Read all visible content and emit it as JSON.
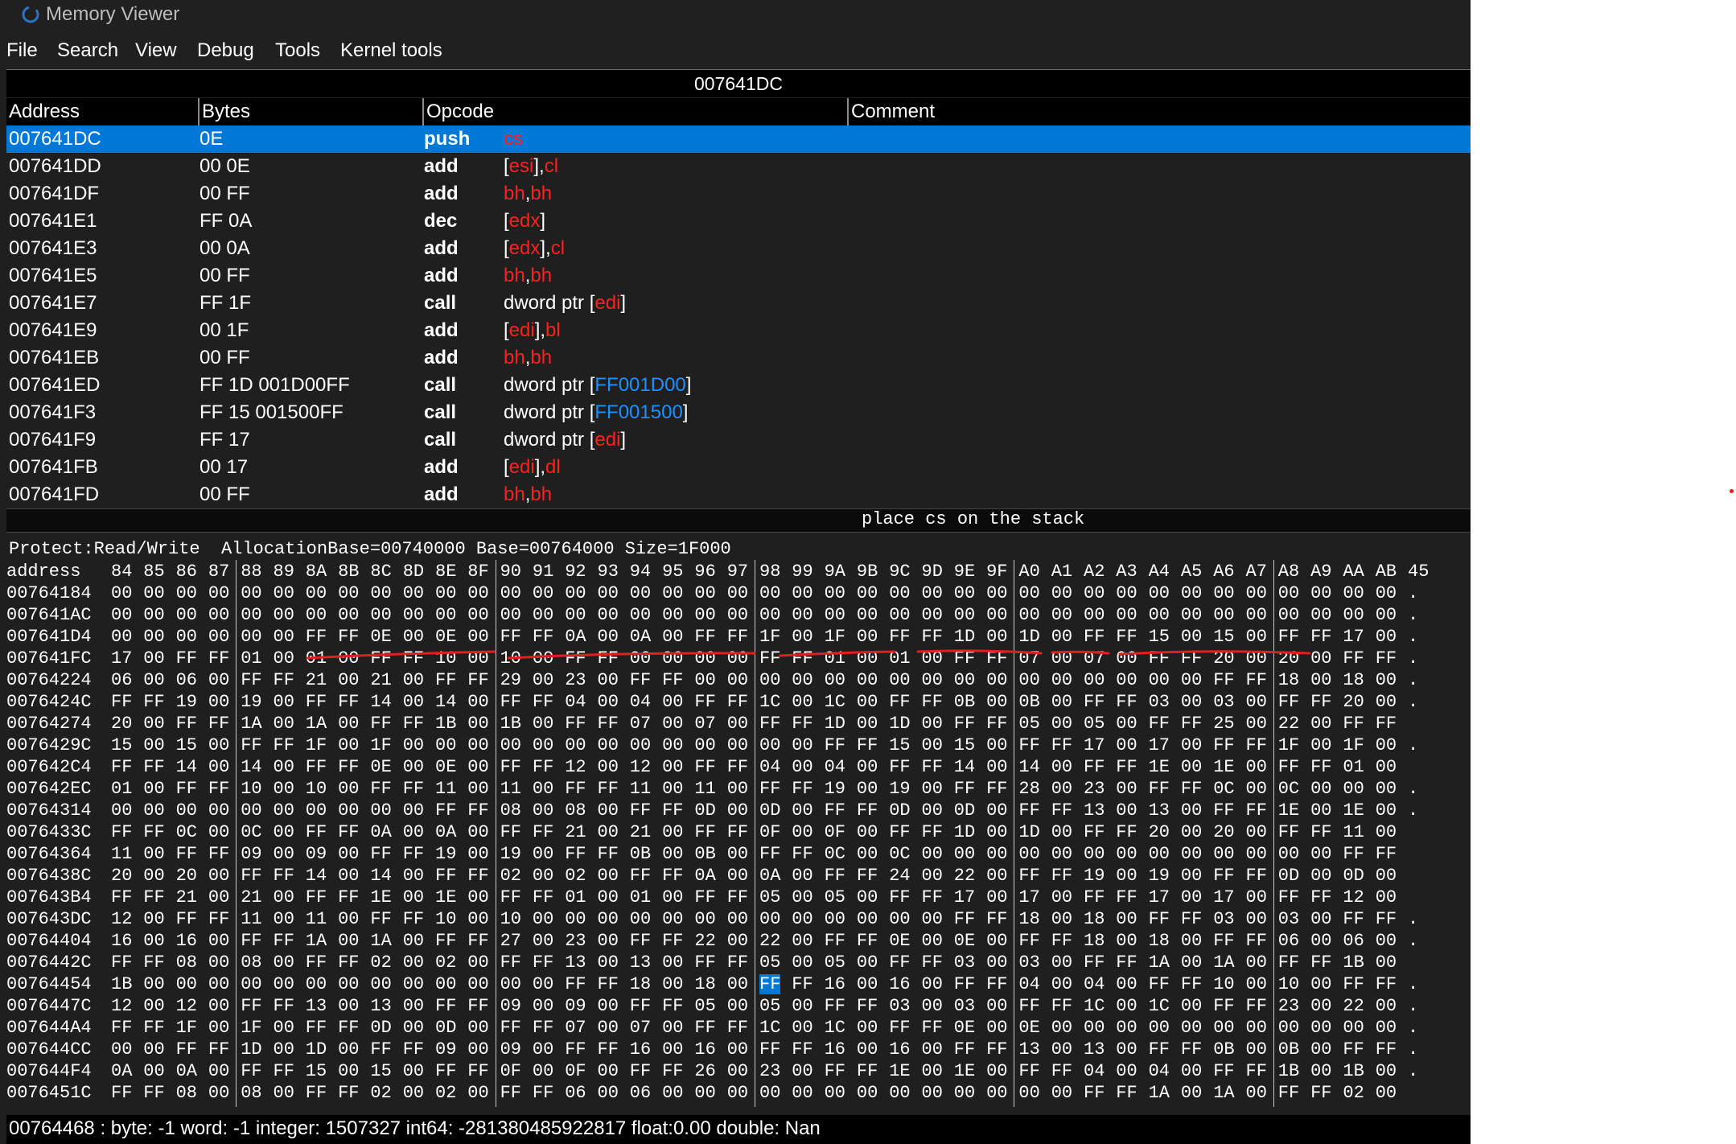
{
  "window": {
    "title": "Memory Viewer"
  },
  "menu": [
    "File",
    "Search",
    "View",
    "Debug",
    "Tools",
    "Kernel tools"
  ],
  "disassembler": {
    "current_address": "007641DC",
    "columns": [
      "Address",
      "Bytes",
      "Opcode",
      "Comment"
    ],
    "rows": [
      {
        "address": "007641DC",
        "bytes": "0E",
        "opcode": "push",
        "args": [
          {
            "t": "cs",
            "k": "reg"
          }
        ],
        "selected": true
      },
      {
        "address": "007641DD",
        "bytes": "00 0E",
        "opcode": "add",
        "args": [
          {
            "t": "[",
            "k": "plain"
          },
          {
            "t": "esi",
            "k": "reg"
          },
          {
            "t": "],",
            "k": "plain"
          },
          {
            "t": "cl",
            "k": "reg"
          }
        ]
      },
      {
        "address": "007641DF",
        "bytes": "00 FF",
        "opcode": "add",
        "args": [
          {
            "t": "bh",
            "k": "reg"
          },
          {
            "t": ",",
            "k": "plain"
          },
          {
            "t": "bh",
            "k": "reg"
          }
        ]
      },
      {
        "address": "007641E1",
        "bytes": "FF 0A",
        "opcode": "dec",
        "args": [
          {
            "t": "[",
            "k": "plain"
          },
          {
            "t": "edx",
            "k": "reg"
          },
          {
            "t": "]",
            "k": "plain"
          }
        ]
      },
      {
        "address": "007641E3",
        "bytes": "00 0A",
        "opcode": "add",
        "args": [
          {
            "t": "[",
            "k": "plain"
          },
          {
            "t": "edx",
            "k": "reg"
          },
          {
            "t": "],",
            "k": "plain"
          },
          {
            "t": "cl",
            "k": "reg"
          }
        ]
      },
      {
        "address": "007641E5",
        "bytes": "00 FF",
        "opcode": "add",
        "args": [
          {
            "t": "bh",
            "k": "reg"
          },
          {
            "t": ",",
            "k": "plain"
          },
          {
            "t": "bh",
            "k": "reg"
          }
        ]
      },
      {
        "address": "007641E7",
        "bytes": "FF 1F",
        "opcode": "call",
        "args": [
          {
            "t": "dword ptr [",
            "k": "plain"
          },
          {
            "t": "edi",
            "k": "reg"
          },
          {
            "t": "]",
            "k": "plain"
          }
        ]
      },
      {
        "address": "007641E9",
        "bytes": "00 1F",
        "opcode": "add",
        "args": [
          {
            "t": "[",
            "k": "plain"
          },
          {
            "t": "edi",
            "k": "reg"
          },
          {
            "t": "],",
            "k": "plain"
          },
          {
            "t": "bl",
            "k": "reg"
          }
        ]
      },
      {
        "address": "007641EB",
        "bytes": "00 FF",
        "opcode": "add",
        "args": [
          {
            "t": "bh",
            "k": "reg"
          },
          {
            "t": ",",
            "k": "plain"
          },
          {
            "t": "bh",
            "k": "reg"
          }
        ]
      },
      {
        "address": "007641ED",
        "bytes": "FF 1D 001D00FF",
        "opcode": "call",
        "args": [
          {
            "t": "dword ptr [",
            "k": "plain"
          },
          {
            "t": "FF001D00",
            "k": "num"
          },
          {
            "t": "]",
            "k": "plain"
          }
        ]
      },
      {
        "address": "007641F3",
        "bytes": "FF 15 001500FF",
        "opcode": "call",
        "args": [
          {
            "t": "dword ptr [",
            "k": "plain"
          },
          {
            "t": "FF001500",
            "k": "num"
          },
          {
            "t": "]",
            "k": "plain"
          }
        ]
      },
      {
        "address": "007641F9",
        "bytes": "FF 17",
        "opcode": "call",
        "args": [
          {
            "t": "dword ptr [",
            "k": "plain"
          },
          {
            "t": "edi",
            "k": "reg"
          },
          {
            "t": "]",
            "k": "plain"
          }
        ]
      },
      {
        "address": "007641FB",
        "bytes": "00 17",
        "opcode": "add",
        "args": [
          {
            "t": "[",
            "k": "plain"
          },
          {
            "t": "edi",
            "k": "reg"
          },
          {
            "t": "],",
            "k": "plain"
          },
          {
            "t": "dl",
            "k": "reg"
          }
        ]
      },
      {
        "address": "007641FD",
        "bytes": "00 FF",
        "opcode": "add",
        "args": [
          {
            "t": "bh",
            "k": "reg"
          },
          {
            "t": ",",
            "k": "plain"
          },
          {
            "t": "bh",
            "k": "reg"
          }
        ]
      }
    ],
    "comment": "place cs on the stack"
  },
  "hexview": {
    "info": "Protect:Read/Write  AllocationBase=00740000 Base=00764000 Size=1F000",
    "header_label": "address",
    "header_cols": [
      "84",
      "85",
      "86",
      "87",
      "88",
      "89",
      "8A",
      "8B",
      "8C",
      "8D",
      "8E",
      "8F",
      "90",
      "91",
      "92",
      "93",
      "94",
      "95",
      "96",
      "97",
      "98",
      "99",
      "9A",
      "9B",
      "9C",
      "9D",
      "9E",
      "9F",
      "A0",
      "A1",
      "A2",
      "A3",
      "A4",
      "A5",
      "A6",
      "A7",
      "A8",
      "A9",
      "AA",
      "AB",
      "45"
    ],
    "rows": [
      {
        "addr": "00764184",
        "bytes": "00 00 00 00 00 00 00 00 00 00 00 00 00 00 00 00 00 00 00 00 00 00 00 00 00 00 00 00 00 00 00 00 00 00 00 00 00 00 00 00",
        "tail": "."
      },
      {
        "addr": "007641AC",
        "bytes": "00 00 00 00 00 00 00 00 00 00 00 00 00 00 00 00 00 00 00 00 00 00 00 00 00 00 00 00 00 00 00 00 00 00 00 00 00 00 00 00",
        "tail": "."
      },
      {
        "addr": "007641D4",
        "bytes": "00 00 00 00 00 00 FF FF 0E 00 0E 00 FF FF 0A 00 0A 00 FF FF 1F 00 1F 00 FF FF 1D 00 1D 00 FF FF 15 00 15 00 FF FF 17 00",
        "tail": "."
      },
      {
        "addr": "007641FC",
        "bytes": "17 00 FF FF 01 00 01 00 FF FF 10 00 10 00 FF FF 00 00 00 00 FF FF 01 00 01 00 FF FF 07 00 07 00 FF FF 20 00 20 00 FF FF",
        "tail": "."
      },
      {
        "addr": "00764224",
        "bytes": "06 00 06 00 FF FF 21 00 21 00 FF FF 29 00 23 00 FF FF 00 00 00 00 00 00 00 00 00 00 00 00 00 00 00 00 FF FF 18 00 18 00",
        "tail": "."
      },
      {
        "addr": "0076424C",
        "bytes": "FF FF 19 00 19 00 FF FF 14 00 14 00 FF FF 04 00 04 00 FF FF 1C 00 1C 00 FF FF 0B 00 0B 00 FF FF 03 00 03 00 FF FF 20 00",
        "tail": "."
      },
      {
        "addr": "00764274",
        "bytes": "20 00 FF FF 1A 00 1A 00 FF FF 1B 00 1B 00 FF FF 07 00 07 00 FF FF 1D 00 1D 00 FF FF 05 00 05 00 FF FF 25 00 22 00 FF FF",
        "tail": ""
      },
      {
        "addr": "0076429C",
        "bytes": "15 00 15 00 FF FF 1F 00 1F 00 00 00 00 00 00 00 00 00 00 00 00 00 FF FF 15 00 15 00 FF FF 17 00 17 00 FF FF 1F 00 1F 00",
        "tail": "."
      },
      {
        "addr": "007642C4",
        "bytes": "FF FF 14 00 14 00 FF FF 0E 00 0E 00 FF FF 12 00 12 00 FF FF 04 00 04 00 FF FF 14 00 14 00 FF FF 1E 00 1E 00 FF FF 01 00",
        "tail": ""
      },
      {
        "addr": "007642EC",
        "bytes": "01 00 FF FF 10 00 10 00 FF FF 11 00 11 00 FF FF 11 00 11 00 FF FF 19 00 19 00 FF FF 28 00 23 00 FF FF 0C 00 0C 00 00 00",
        "tail": "."
      },
      {
        "addr": "00764314",
        "bytes": "00 00 00 00 00 00 00 00 00 00 FF FF 08 00 08 00 FF FF 0D 00 0D 00 FF FF 0D 00 0D 00 FF FF 13 00 13 00 FF FF 1E 00 1E 00",
        "tail": "."
      },
      {
        "addr": "0076433C",
        "bytes": "FF FF 0C 00 0C 00 FF FF 0A 00 0A 00 FF FF 21 00 21 00 FF FF 0F 00 0F 00 FF FF 1D 00 1D 00 FF FF 20 00 20 00 FF FF 11 00",
        "tail": ""
      },
      {
        "addr": "00764364",
        "bytes": "11 00 FF FF 09 00 09 00 FF FF 19 00 19 00 FF FF 0B 00 0B 00 FF FF 0C 00 0C 00 00 00 00 00 00 00 00 00 00 00 00 00 FF FF",
        "tail": ""
      },
      {
        "addr": "0076438C",
        "bytes": "20 00 20 00 FF FF 14 00 14 00 FF FF 02 00 02 00 FF FF 0A 00 0A 00 FF FF 24 00 22 00 FF FF 19 00 19 00 FF FF 0D 00 0D 00",
        "tail": ""
      },
      {
        "addr": "007643B4",
        "bytes": "FF FF 21 00 21 00 FF FF 1E 00 1E 00 FF FF 01 00 01 00 FF FF 05 00 05 00 FF FF 17 00 17 00 FF FF 17 00 17 00 FF FF 12 00",
        "tail": ""
      },
      {
        "addr": "007643DC",
        "bytes": "12 00 FF FF 11 00 11 00 FF FF 10 00 10 00 00 00 00 00 00 00 00 00 00 00 00 00 FF FF 18 00 18 00 FF FF 03 00 03 00 FF FF",
        "tail": "."
      },
      {
        "addr": "00764404",
        "bytes": "16 00 16 00 FF FF 1A 00 1A 00 FF FF 27 00 23 00 FF FF 22 00 22 00 FF FF 0E 00 0E 00 FF FF 18 00 18 00 FF FF 06 00 06 00",
        "tail": "."
      },
      {
        "addr": "0076442C",
        "bytes": "FF FF 08 00 08 00 FF FF 02 00 02 00 FF FF 13 00 13 00 FF FF 05 00 05 00 FF FF 03 00 03 00 FF FF 1A 00 1A 00 FF FF 1B 00",
        "tail": ""
      },
      {
        "addr": "00764454",
        "bytes": "1B 00 00 00 00 00 00 00 00 00 00 00 00 00 FF FF 18 00 18 00 FF FF 16 00 16 00 FF FF 04 00 04 00 FF FF 10 00 10 00 FF FF",
        "tail": "."
      },
      {
        "addr": "0076447C",
        "bytes": "12 00 12 00 FF FF 13 00 13 00 FF FF 09 00 09 00 FF FF 05 00 05 00 FF FF 03 00 03 00 FF FF 1C 00 1C 00 FF FF 23 00 22 00",
        "tail": "."
      },
      {
        "addr": "007644A4",
        "bytes": "FF FF 1F 00 1F 00 FF FF 0D 00 0D 00 FF FF 07 00 07 00 FF FF 1C 00 1C 00 FF FF 0E 00 0E 00 00 00 00 00 00 00 00 00 00 00",
        "tail": "."
      },
      {
        "addr": "007644CC",
        "bytes": "00 00 FF FF 1D 00 1D 00 FF FF 09 00 09 00 FF FF 16 00 16 00 FF FF 16 00 16 00 FF FF 13 00 13 00 FF FF 0B 00 0B 00 FF FF",
        "tail": "."
      },
      {
        "addr": "007644F4",
        "bytes": "0A 00 0A 00 FF FF 15 00 15 00 FF FF 0F 00 0F 00 FF FF 26 00 23 00 FF FF 1E 00 1E 00 FF FF 04 00 04 00 FF FF 1B 00 1B 00",
        "tail": "."
      },
      {
        "addr": "0076451C",
        "bytes": "FF FF 08 00 08 00 FF FF 02 00 02 00 FF FF 06 00 06 00 00 00 00 00 00 00 00 00 00 00 00 00 FF FF 1A 00 1A 00 FF FF 02 00",
        "tail": ""
      }
    ],
    "selected_byte": {
      "row": 18,
      "col": 20,
      "value": "FF"
    },
    "status": "00764468 : byte: -1 word: -1 integer: 1507327 int64: -281380485922817 float:0.00 double: Nan"
  },
  "colors": {
    "selection": "#0078d7",
    "register": "#ff2020",
    "number": "#1e90ff",
    "annotation": "#e02020"
  }
}
